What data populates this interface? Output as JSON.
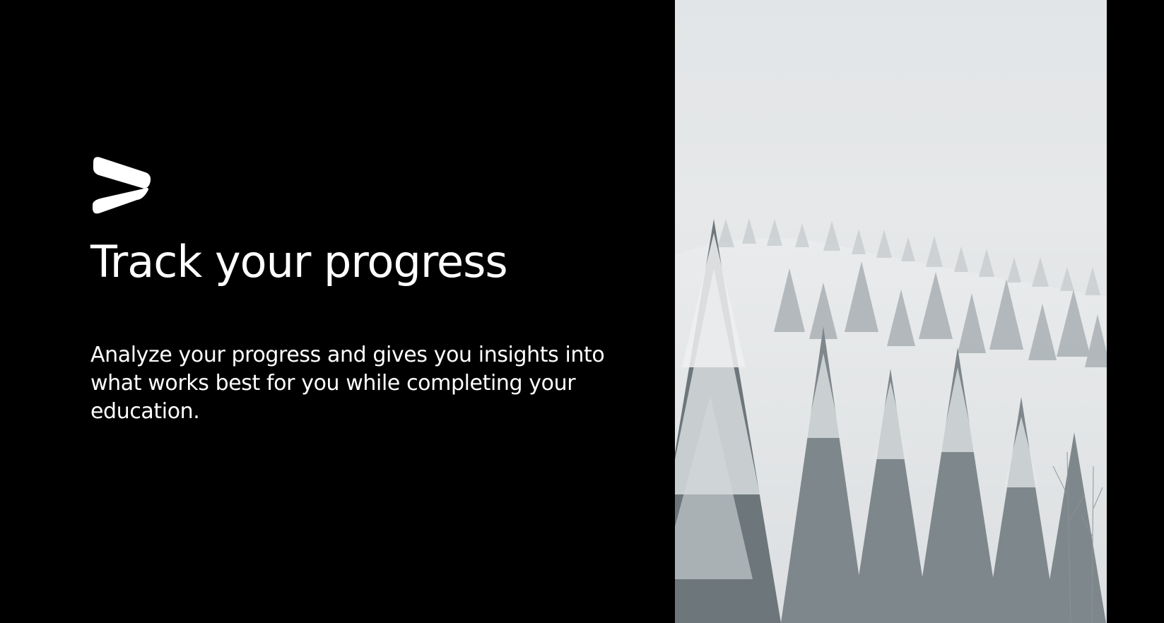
{
  "slide": {
    "title": "Track your progress",
    "description": "Analyze your progress and gives you insights into what works best for you while completing your education."
  },
  "logo": {
    "icon": "play-arrow-logo-icon",
    "color": "#ffffff"
  },
  "image": {
    "subject": "snow-covered-pine-forest",
    "background_color": "#000000"
  }
}
